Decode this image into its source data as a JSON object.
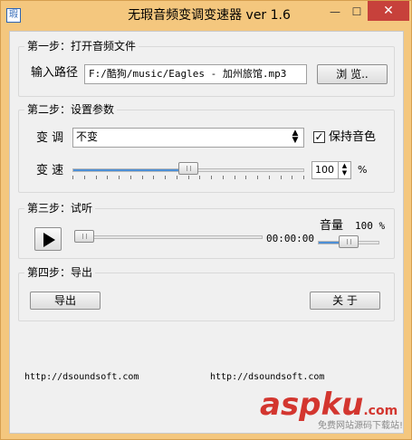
{
  "window": {
    "title": "无瑕音频变调变速器 ver 1.6",
    "icon_label": "瑕",
    "minimize": "—",
    "maximize": "☐",
    "close": "✕"
  },
  "step1": {
    "title": "第一步：打开音频文件",
    "path_label": "输入路径",
    "path_value": "F:/酷狗/music/Eagles - 加州旅馆.mp3",
    "browse_label": "浏 览.."
  },
  "step2": {
    "title": "第二步：设置参数",
    "pitch_label": "变 调",
    "pitch_selected": "不变",
    "keep_pitch_label": "保持音色",
    "keep_pitch_checked": true,
    "speed_label": "变 速",
    "speed_value": "100",
    "speed_unit": "%",
    "speed_slider_fraction": 0.5
  },
  "step3": {
    "title": "第三步：试听",
    "time": "00:00:00",
    "progress_fraction": 0.0,
    "volume_label": "音量",
    "volume_value": "100 %",
    "volume_fraction": 0.5
  },
  "step4": {
    "title": "第四步：导出",
    "export_label": "导出",
    "close_label": "关 于"
  },
  "footer": {
    "url_left": "http://dsoundsoft.com",
    "url_right": "http://dsoundsoft.com"
  },
  "watermark": {
    "main": "aspku",
    "domain": ".com",
    "sub": "免费网站源码下载站!"
  },
  "colors": {
    "frame": "#f4c77e",
    "accent": "#4c8fd6",
    "close_button": "#c7413b",
    "watermark": "#d3362f"
  }
}
